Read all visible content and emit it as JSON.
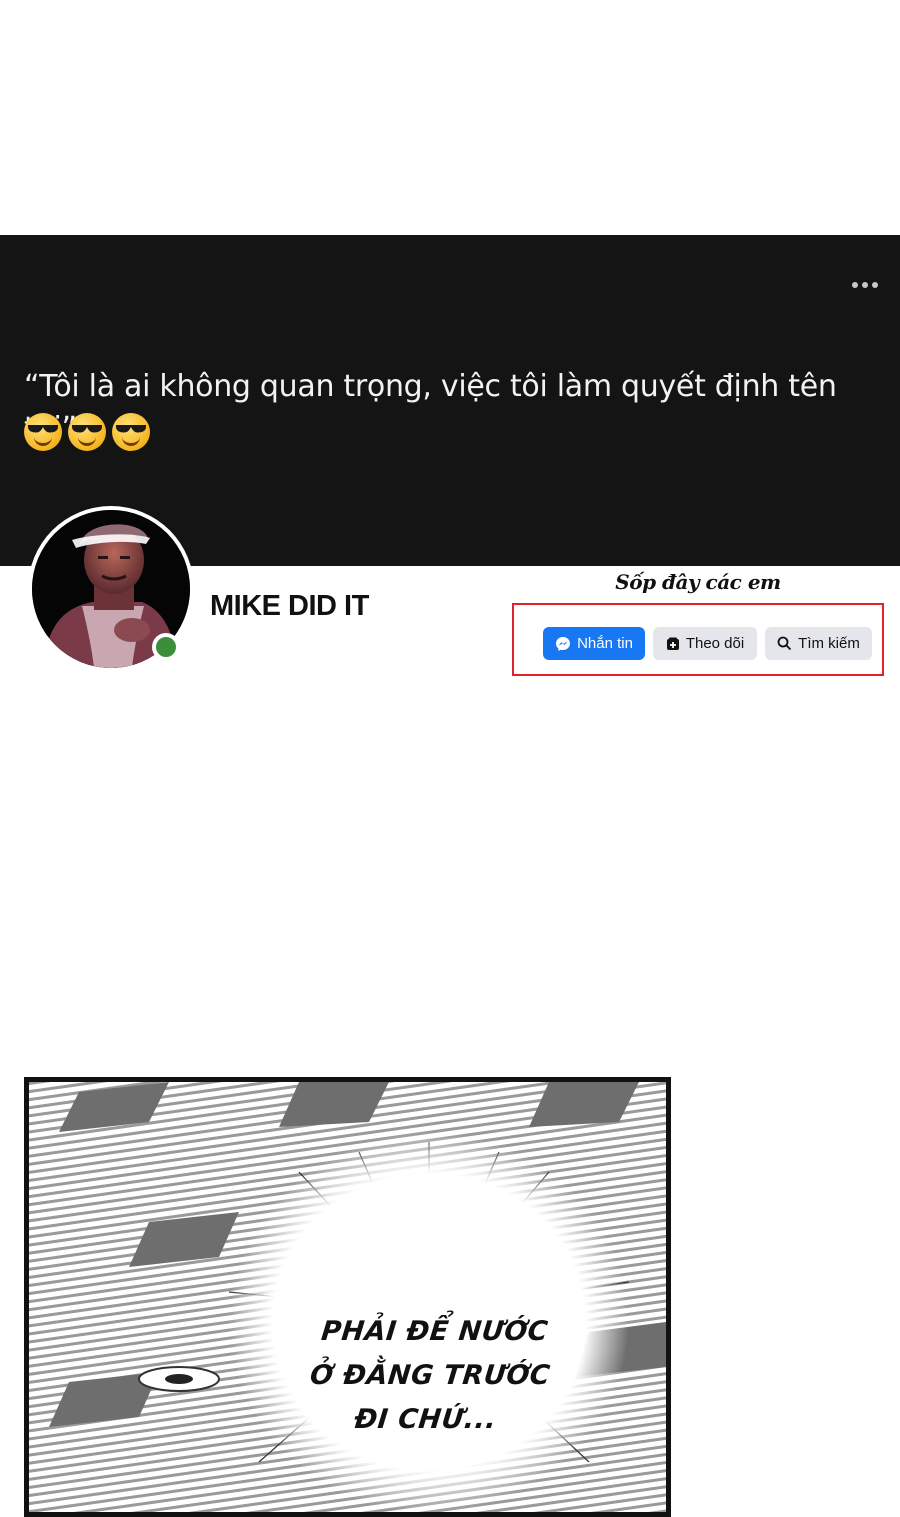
{
  "profile": {
    "bio_quote": "“Tôi là ai không quan trọng, việc tôi làm quyết định tên tôi”",
    "bio_emojis": [
      "sunglasses-emoji",
      "sunglasses-emoji",
      "sunglasses-emoji"
    ],
    "name": "MIKE DID IT",
    "online": true
  },
  "annotation": {
    "caption": "Sốp đây các em",
    "box_color": "#e0232a"
  },
  "actions": {
    "message_label": "Nhắn tin",
    "message_icon": "messenger-icon",
    "follow_label": "Theo dõi",
    "follow_icon": "follow-icon",
    "search_label": "Tìm kiếm",
    "search_icon": "search-icon"
  },
  "manga_panel": {
    "speech_lines": [
      "PHẢI ĐỂ NƯỚC",
      "Ở ĐẰNG TRƯỚC",
      "ĐI CHỨ..."
    ]
  },
  "colors": {
    "cover_bg": "#141414",
    "primary_button": "#1877f2",
    "secondary_button": "#e4e6eb",
    "online": "#3b8f3a"
  }
}
